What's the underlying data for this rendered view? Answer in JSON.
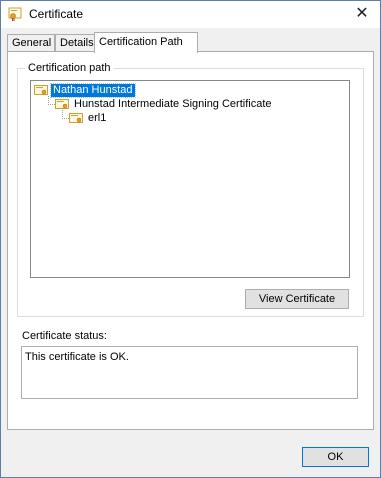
{
  "window": {
    "title": "Certificate",
    "close_glyph": "✕"
  },
  "tabs": [
    {
      "label": "General",
      "active": false
    },
    {
      "label": "Details",
      "active": false
    },
    {
      "label": "Certification Path",
      "active": true
    }
  ],
  "path_group": {
    "label": "Certification path",
    "tree": [
      {
        "label": "Nathan Hunstad",
        "level": 0,
        "selected": true
      },
      {
        "label": "Hunstad Intermediate Signing Certificate",
        "level": 1,
        "selected": false
      },
      {
        "label": "erl1",
        "level": 2,
        "selected": false
      }
    ],
    "view_button_label": "View Certificate"
  },
  "status": {
    "label": "Certificate status:",
    "text": "This certificate is OK."
  },
  "footer": {
    "ok_label": "OK"
  },
  "colors": {
    "selection": "#0078d7",
    "certificate_icon": "#f0c040"
  }
}
